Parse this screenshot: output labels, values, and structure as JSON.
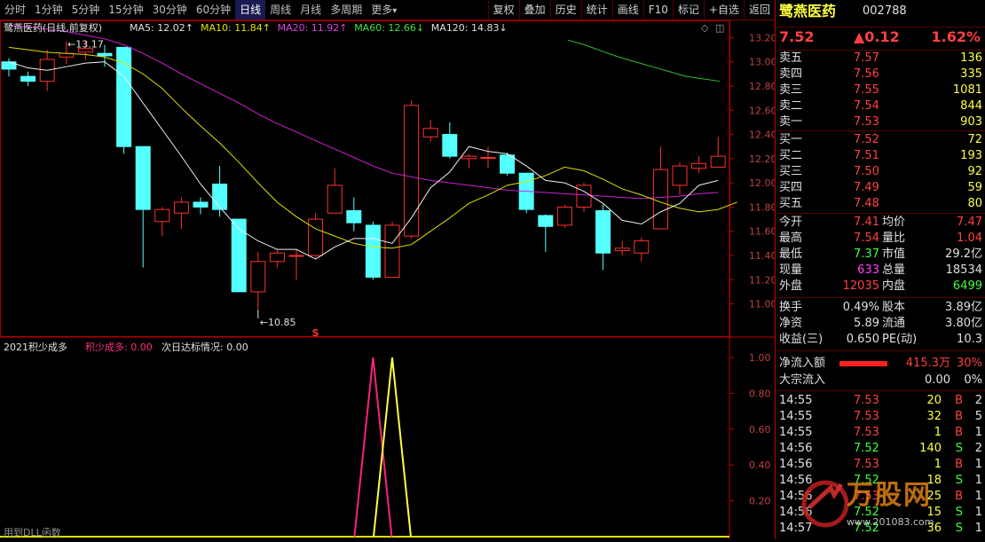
{
  "toolbar": {
    "periods": [
      "分时",
      "1分钟",
      "5分钟",
      "15分钟",
      "30分钟",
      "60分钟",
      "日线",
      "周线",
      "月线",
      "多周期",
      "更多"
    ],
    "active_period": "日线",
    "more_arrow": "▾",
    "actions": [
      "复权",
      "叠加",
      "历史",
      "统计",
      "画线",
      "F10",
      "标记",
      "+自选",
      "返回"
    ]
  },
  "main_chart": {
    "title": "鹭燕医药(日线,前复权)",
    "ma": [
      {
        "label": "MA5: 12.02",
        "arrow": "↑",
        "color": "#e0e0e0"
      },
      {
        "label": "MA10: 11.84",
        "arrow": "↑",
        "color": "#e0e000"
      },
      {
        "label": "MA20: 11.92",
        "arrow": "↑",
        "color": "#e040e0"
      },
      {
        "label": "MA60: 12.66",
        "arrow": "↓",
        "color": "#40e040"
      },
      {
        "label": "MA120: 14.83",
        "arrow": "↓",
        "color": "#e0e0e0"
      }
    ],
    "high_marker": "13.17",
    "low_marker": "10.85",
    "s_marker": "S",
    "y_ticks": [
      "13.20",
      "13.00",
      "12.80",
      "12.60",
      "12.40",
      "12.20",
      "12.00",
      "11.80",
      "11.60",
      "11.40",
      "11.20",
      "11.00"
    ]
  },
  "indicator": {
    "title": "2021积少成多",
    "param_label": "积少成多: 0.00",
    "next_label": "次日达标情况: 0.00",
    "y_ticks": [
      "1.00",
      "0.80",
      "0.60",
      "0.40",
      "0.20"
    ],
    "bottom_label": "用到DLL函数"
  },
  "chart_data": {
    "type": "candlestick",
    "candles": [
      {
        "o": 13.0,
        "c": 12.94,
        "h": 13.03,
        "l": 12.88
      },
      {
        "o": 12.88,
        "c": 12.84,
        "h": 12.92,
        "l": 12.8
      },
      {
        "o": 12.84,
        "c": 13.02,
        "h": 13.1,
        "l": 12.76
      },
      {
        "o": 13.04,
        "c": 13.07,
        "h": 13.17,
        "l": 12.98
      },
      {
        "o": 13.08,
        "c": 13.11,
        "h": 13.17,
        "l": 13.02
      },
      {
        "o": 13.07,
        "c": 13.05,
        "h": 13.14,
        "l": 12.96
      },
      {
        "o": 13.12,
        "c": 12.3,
        "h": 13.12,
        "l": 12.24
      },
      {
        "o": 12.3,
        "c": 11.78,
        "h": 12.3,
        "l": 11.3
      },
      {
        "o": 11.68,
        "c": 11.78,
        "h": 11.8,
        "l": 11.56
      },
      {
        "o": 11.75,
        "c": 11.84,
        "h": 11.88,
        "l": 11.62
      },
      {
        "o": 11.84,
        "c": 11.8,
        "h": 11.88,
        "l": 11.74
      },
      {
        "o": 11.99,
        "c": 11.78,
        "h": 12.14,
        "l": 11.72
      },
      {
        "o": 11.7,
        "c": 11.1,
        "h": 11.7,
        "l": 11.1
      },
      {
        "o": 11.1,
        "c": 11.35,
        "h": 11.43,
        "l": 10.95
      },
      {
        "o": 11.35,
        "c": 11.42,
        "h": 11.45,
        "l": 11.3
      },
      {
        "o": 11.4,
        "c": 11.4,
        "h": 11.45,
        "l": 11.2
      },
      {
        "o": 11.4,
        "c": 11.7,
        "h": 11.75,
        "l": 11.38
      },
      {
        "o": 11.75,
        "c": 11.98,
        "h": 12.12,
        "l": 11.75
      },
      {
        "o": 11.77,
        "c": 11.67,
        "h": 11.88,
        "l": 11.6
      },
      {
        "o": 11.65,
        "c": 11.22,
        "h": 11.68,
        "l": 11.2
      },
      {
        "o": 11.22,
        "c": 11.65,
        "h": 11.68,
        "l": 11.22
      },
      {
        "o": 11.56,
        "c": 12.64,
        "h": 12.68,
        "l": 11.54
      },
      {
        "o": 12.38,
        "c": 12.45,
        "h": 12.52,
        "l": 12.34
      },
      {
        "o": 12.4,
        "c": 12.22,
        "h": 12.5,
        "l": 12.2
      },
      {
        "o": 12.2,
        "c": 12.22,
        "h": 12.24,
        "l": 12.12
      },
      {
        "o": 12.21,
        "c": 12.21,
        "h": 12.3,
        "l": 12.12
      },
      {
        "o": 12.23,
        "c": 12.08,
        "h": 12.25,
        "l": 12.06
      },
      {
        "o": 12.08,
        "c": 11.78,
        "h": 12.08,
        "l": 11.75
      },
      {
        "o": 11.73,
        "c": 11.64,
        "h": 11.74,
        "l": 11.43
      },
      {
        "o": 11.65,
        "c": 11.8,
        "h": 11.82,
        "l": 11.63
      },
      {
        "o": 11.8,
        "c": 11.98,
        "h": 12.0,
        "l": 11.76
      },
      {
        "o": 11.77,
        "c": 11.42,
        "h": 11.82,
        "l": 11.28
      },
      {
        "o": 11.44,
        "c": 11.46,
        "h": 11.52,
        "l": 11.4
      },
      {
        "o": 11.42,
        "c": 11.52,
        "h": 11.55,
        "l": 11.35
      },
      {
        "o": 11.62,
        "c": 12.11,
        "h": 12.3,
        "l": 11.62
      },
      {
        "o": 11.98,
        "c": 12.14,
        "h": 12.17,
        "l": 11.9
      },
      {
        "o": 12.12,
        "c": 12.16,
        "h": 12.22,
        "l": 12.08
      },
      {
        "o": 12.13,
        "c": 12.22,
        "h": 12.38,
        "l": 12.13
      }
    ],
    "ma5": [
      13.0,
      12.95,
      12.93,
      12.96,
      12.99,
      13.0,
      12.88,
      12.66,
      12.44,
      12.22,
      11.99,
      11.8,
      11.62,
      11.52,
      11.45,
      11.45,
      11.37,
      11.47,
      11.54,
      11.54,
      11.5,
      11.71,
      11.96,
      12.09,
      12.3,
      12.26,
      12.24,
      12.14,
      12.02,
      12.0,
      11.93,
      11.83,
      11.69,
      11.66,
      11.76,
      11.83,
      11.98,
      12.02
    ],
    "ma10": [
      13.12,
      13.1,
      13.08,
      13.07,
      13.06,
      13.04,
      12.99,
      12.9,
      12.78,
      12.62,
      12.47,
      12.33,
      12.17,
      12.0,
      11.84,
      11.72,
      11.62,
      11.56,
      11.5,
      11.47,
      11.46,
      11.49,
      11.6,
      11.71,
      11.83,
      11.9,
      11.98,
      12.01,
      12.06,
      12.13,
      12.1,
      12.03,
      11.95,
      11.9,
      11.84,
      11.79,
      11.76,
      11.78,
      11.84
    ],
    "ma20": [
      13.3,
      13.29,
      13.27,
      13.25,
      13.22,
      13.19,
      13.14,
      13.07,
      12.99,
      12.9,
      12.82,
      12.74,
      12.66,
      12.57,
      12.49,
      12.42,
      12.35,
      12.28,
      12.21,
      12.14,
      12.08,
      12.05,
      12.02,
      12.0,
      11.98,
      11.96,
      11.94,
      11.93,
      11.92,
      11.91,
      11.9,
      11.89,
      11.88,
      11.87,
      11.88,
      11.89,
      11.91,
      11.92
    ],
    "ma60_segment": [
      13.0,
      12.96,
      12.91,
      12.86,
      12.82,
      12.78,
      12.74,
      12.7,
      12.68,
      12.66
    ],
    "indicator_pink": {
      "rise_idx": 19,
      "value": 1.0
    },
    "indicator_yellow": {
      "rise_idx": 20,
      "value": 1.0
    },
    "ylim": [
      10.85,
      13.24
    ]
  },
  "quote": {
    "name": "鹭燕医药",
    "code": "002788",
    "price": "7.52",
    "change": "▲0.12",
    "change_pct": "1.62%",
    "asks": [
      {
        "label": "卖五",
        "price": "7.57",
        "vol": "136"
      },
      {
        "label": "卖四",
        "price": "7.56",
        "vol": "335"
      },
      {
        "label": "卖三",
        "price": "7.55",
        "vol": "1081"
      },
      {
        "label": "卖二",
        "price": "7.54",
        "vol": "844"
      },
      {
        "label": "卖一",
        "price": "7.53",
        "vol": "903"
      }
    ],
    "bids": [
      {
        "label": "买一",
        "price": "7.52",
        "vol": "72"
      },
      {
        "label": "买二",
        "price": "7.51",
        "vol": "193"
      },
      {
        "label": "买三",
        "price": "7.50",
        "vol": "92"
      },
      {
        "label": "买四",
        "price": "7.49",
        "vol": "59"
      },
      {
        "label": "买五",
        "price": "7.48",
        "vol": "80"
      }
    ],
    "stats": [
      {
        "l1": "今开",
        "v1": "7.41",
        "c1": "red",
        "l2": "均价",
        "v2": "7.47",
        "c2": "red"
      },
      {
        "l1": "最高",
        "v1": "7.54",
        "c1": "red",
        "l2": "量比",
        "v2": "1.04",
        "c2": "red"
      },
      {
        "l1": "最低",
        "v1": "7.37",
        "c1": "green",
        "l2": "市值",
        "v2": "29.2亿",
        "c2": "white"
      },
      {
        "l1": "现量",
        "v1": "633",
        "c1": "magenta",
        "l2": "总量",
        "v2": "18534",
        "c2": "white"
      },
      {
        "l1": "外盘",
        "v1": "12035",
        "c1": "red",
        "l2": "内盘",
        "v2": "6499",
        "c2": "green"
      }
    ],
    "fin": [
      {
        "l1": "换手",
        "v1": "0.49%",
        "l2": "股本",
        "v2": "3.89亿"
      },
      {
        "l1": "净资",
        "v1": "5.89",
        "l2": "流通",
        "v2": "3.80亿"
      },
      {
        "l1": "收益(三)",
        "v1": "0.650",
        "l2": "PE(动)",
        "v2": "10.3"
      }
    ],
    "flow": {
      "label": "净流入额",
      "value": "415.3万",
      "pct": "30%",
      "big_label": "大宗流入",
      "big_value": "0.00",
      "big_pct": "0%"
    },
    "ticks": [
      {
        "t": "14:55",
        "p": "7.53",
        "v": "20",
        "bs": "B",
        "n": "2"
      },
      {
        "t": "14:55",
        "p": "7.53",
        "v": "32",
        "bs": "B",
        "n": "5"
      },
      {
        "t": "14:55",
        "p": "7.53",
        "v": "1",
        "bs": "B",
        "n": "1"
      },
      {
        "t": "14:56",
        "p": "7.52",
        "v": "140",
        "bs": "S",
        "n": "2"
      },
      {
        "t": "14:56",
        "p": "7.53",
        "v": "1",
        "bs": "B",
        "n": "1"
      },
      {
        "t": "14:56",
        "p": "7.52",
        "v": "18",
        "bs": "S",
        "n": "1"
      },
      {
        "t": "14:56",
        "p": "7.53",
        "v": "25",
        "bs": "B",
        "n": "1"
      },
      {
        "t": "14:56",
        "p": "7.52",
        "v": "15",
        "bs": "S",
        "n": "1"
      },
      {
        "t": "14:57",
        "p": "7.52",
        "v": "36",
        "bs": "S",
        "n": "1"
      }
    ],
    "watermark": {
      "brand": "万股网",
      "url": "www.201083.com"
    }
  }
}
